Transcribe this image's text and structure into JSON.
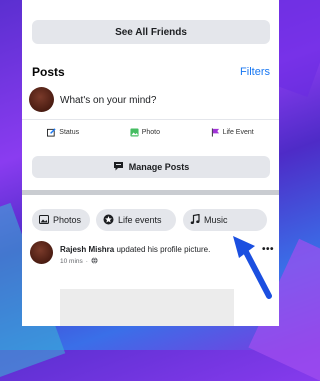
{
  "buttons": {
    "see_all_friends": "See All Friends",
    "manage_posts": "Manage Posts"
  },
  "posts_section": {
    "title": "Posts",
    "filters": "Filters",
    "composer_placeholder": "What's on your mind?"
  },
  "composer_actions": [
    {
      "label": "Status",
      "icon": "edit-icon"
    },
    {
      "label": "Photo",
      "icon": "photo-icon"
    },
    {
      "label": "Life Event",
      "icon": "flag-icon"
    }
  ],
  "filter_chips": [
    {
      "label": "Photos",
      "icon": "photos-icon"
    },
    {
      "label": "Life events",
      "icon": "star-icon"
    },
    {
      "label": "Music",
      "icon": "music-note-icon"
    }
  ],
  "feed_post": {
    "author": "Rajesh Mishra",
    "action": "updated his profile picture.",
    "time": "10 mins",
    "separator": "·"
  },
  "colors": {
    "accent": "#1877f2",
    "button_bg": "#e4e6eb",
    "arrow": "#1b4fe0"
  }
}
